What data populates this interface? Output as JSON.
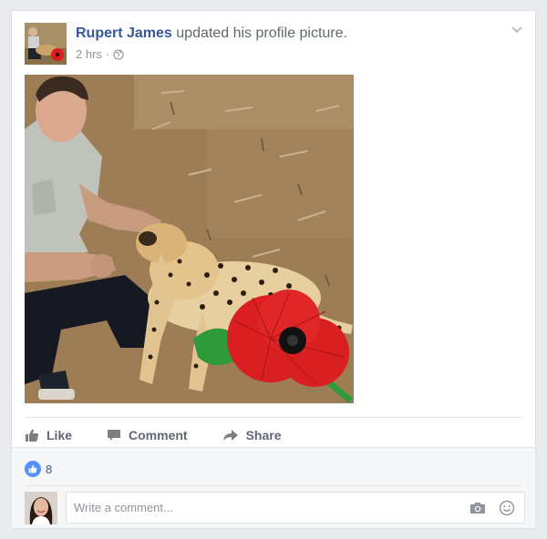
{
  "post": {
    "author": "Rupert James",
    "action_text": "updated his profile picture.",
    "timestamp": "2 hrs",
    "separator": "·",
    "privacy_icon": "globe-icon",
    "options_icon": "chevron-down-icon"
  },
  "actions": {
    "like_label": "Like",
    "comment_label": "Comment",
    "share_label": "Share"
  },
  "reactions": {
    "like_count": "8"
  },
  "comment": {
    "placeholder": "Write a comment...",
    "value": ""
  },
  "colors": {
    "author": "#365899",
    "muted": "#90949c",
    "action_text": "#616770",
    "like_blue": "#5890ff",
    "poppy_red": "#d91f1f"
  }
}
